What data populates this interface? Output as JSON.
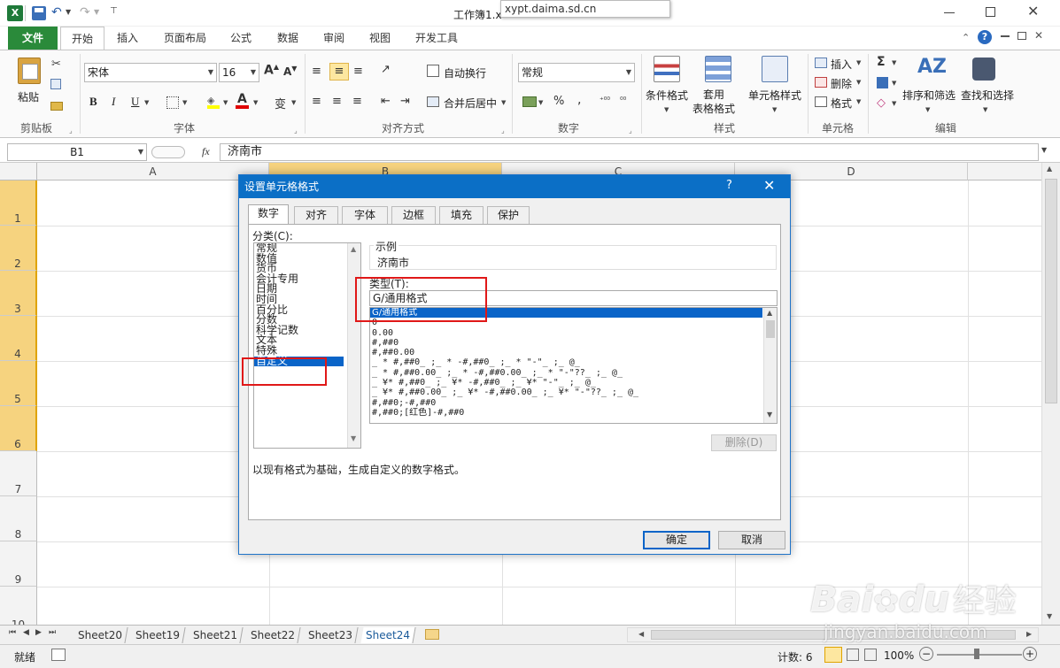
{
  "window": {
    "title": "工作簿1.x",
    "url_tooltip": "xypt.daima.sd.cn"
  },
  "ribbon_tabs": [
    "文件",
    "开始",
    "插入",
    "页面布局",
    "公式",
    "数据",
    "审阅",
    "视图",
    "开发工具"
  ],
  "ribbon": {
    "clipboard": {
      "paste": "粘贴",
      "label": "剪贴板"
    },
    "font": {
      "name": "宋体",
      "size": "16",
      "label": "字体",
      "bold": "B",
      "italic": "I",
      "underline": "U",
      "color_a": "A",
      "phonetic": "变"
    },
    "alignment": {
      "wrap": "自动换行",
      "merge": "合并后居中",
      "label": "对齐方式"
    },
    "number": {
      "format": "常规",
      "label": "数字",
      "percent": "%",
      "comma": ","
    },
    "styles": {
      "conditional": "条件格式",
      "table": "套用\n表格格式",
      "cell_style": "单元格样式",
      "label": "样式"
    },
    "cells": {
      "insert": "插入",
      "delete": "删除",
      "format": "格式",
      "label": "单元格"
    },
    "editing": {
      "sort": "排序和筛选",
      "find": "查找和选择",
      "label": "编辑",
      "sigma": "Σ"
    }
  },
  "formula_bar": {
    "name_box": "B1",
    "fx": "fx",
    "value": "济南市"
  },
  "columns": [
    "A",
    "B",
    "C",
    "D"
  ],
  "rows": [
    "1",
    "2",
    "3",
    "4",
    "5",
    "6",
    "7",
    "8",
    "9",
    "10"
  ],
  "sheets": [
    "Sheet20",
    "Sheet19",
    "Sheet21",
    "Sheet22",
    "Sheet23",
    "Sheet24"
  ],
  "status": {
    "ready": "就绪",
    "count": "计数: 6",
    "zoom": "100%"
  },
  "dialog": {
    "title": "设置单元格格式",
    "help": "?",
    "tabs": [
      "数字",
      "对齐",
      "字体",
      "边框",
      "填充",
      "保护"
    ],
    "category_label": "分类(C):",
    "categories": [
      "常规",
      "数值",
      "货币",
      "会计专用",
      "日期",
      "时间",
      "百分比",
      "分数",
      "科学记数",
      "文本",
      "特殊",
      "自定义"
    ],
    "selected_category": 11,
    "sample_label": "示例",
    "sample_value": "济南市",
    "type_label": "类型(T):",
    "type_value": "G/通用格式",
    "type_list": [
      "G/通用格式",
      "0",
      "0.00",
      "#,##0",
      "#,##0.00",
      "_ * #,##0_ ;_ * -#,##0_ ;_ * \"-\"_ ;_ @_",
      "_ * #,##0.00_ ;_ * -#,##0.00_ ;_ * \"-\"??_ ;_ @_",
      "_ ¥* #,##0_ ;_ ¥* -#,##0_ ;_ ¥* \"-\"_ ;_ @_",
      "_ ¥* #,##0.00_ ;_ ¥* -#,##0.00_ ;_ ¥* \"-\"??_ ;_ @_",
      "#,##0;-#,##0",
      "#,##0;[红色]-#,##0"
    ],
    "delete_button": "删除(D)",
    "description": "以现有格式为基础，生成自定义的数字格式。",
    "ok": "确定",
    "cancel": "取消"
  },
  "watermark": {
    "brand": "Bai",
    "paw": "du",
    "cn": "经验",
    "site": "jingyan.baidu.com"
  }
}
